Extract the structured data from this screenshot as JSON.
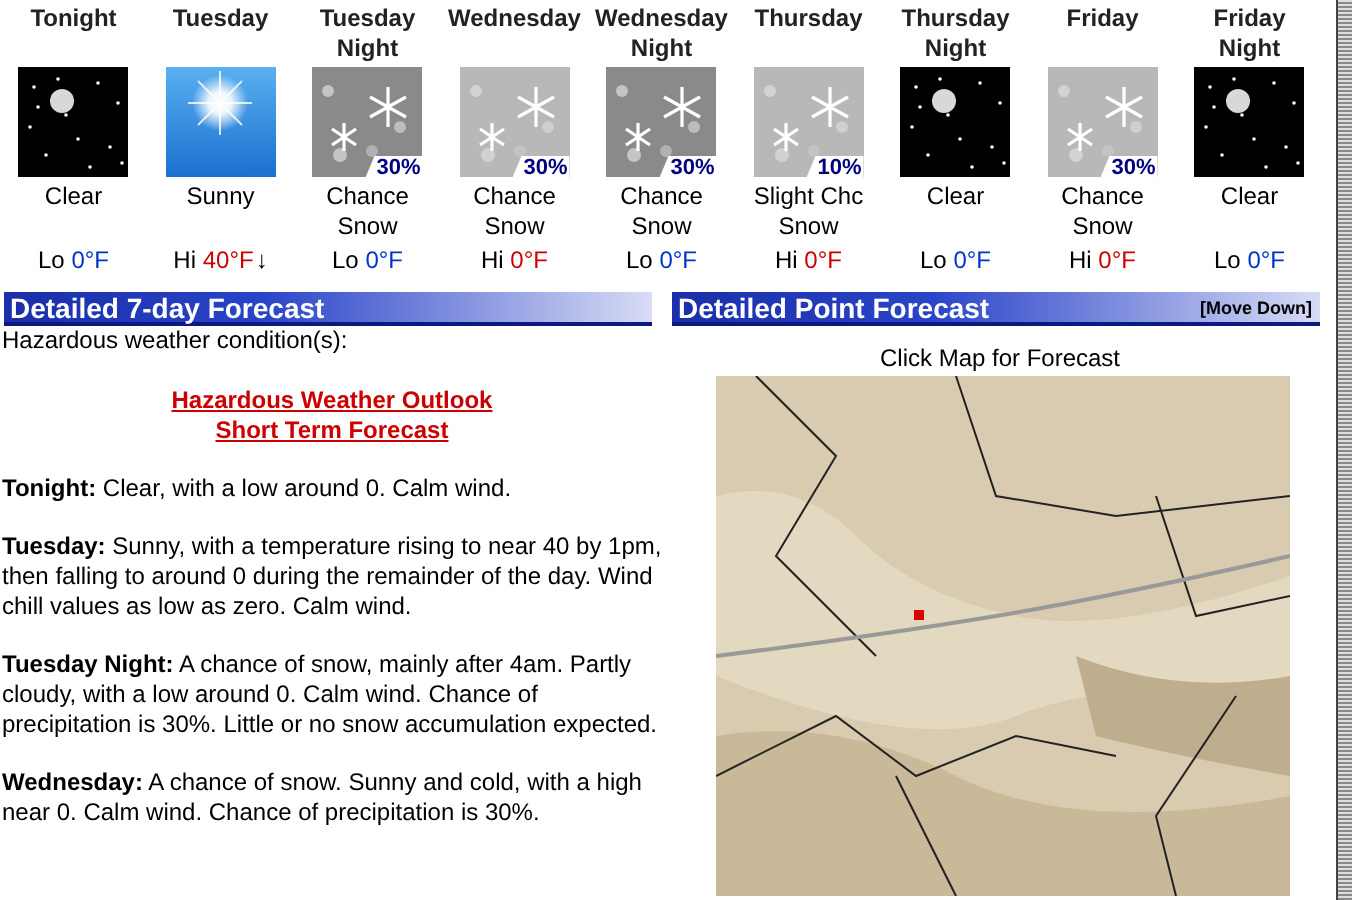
{
  "periods": [
    {
      "title": [
        "Tonight"
      ],
      "kind": "clear-night",
      "condition": "Clear",
      "temp_label": "Lo",
      "temp": "0°F",
      "color": "#0033cc"
    },
    {
      "title": [
        "Tuesday"
      ],
      "kind": "sunny",
      "condition": "Sunny",
      "temp_label": "Hi",
      "temp": "40°F",
      "color": "#cc0000",
      "trend": "↓"
    },
    {
      "title": [
        "Tuesday",
        "Night"
      ],
      "kind": "snow",
      "chance": "30%",
      "condition": "Chance Snow",
      "temp_label": "Lo",
      "temp": "0°F",
      "color": "#0033cc"
    },
    {
      "title": [
        "Wednesday"
      ],
      "kind": "snow",
      "chance": "30%",
      "condition": "Chance Snow",
      "temp_label": "Hi",
      "temp": "0°F",
      "color": "#cc0000"
    },
    {
      "title": [
        "Wednesday",
        "Night"
      ],
      "kind": "snow",
      "chance": "30%",
      "condition": "Chance Snow",
      "temp_label": "Lo",
      "temp": "0°F",
      "color": "#0033cc"
    },
    {
      "title": [
        "Thursday"
      ],
      "kind": "snow",
      "chance": "10%",
      "condition": "Slight Chc Snow",
      "temp_label": "Hi",
      "temp": "0°F",
      "color": "#cc0000"
    },
    {
      "title": [
        "Thursday",
        "Night"
      ],
      "kind": "clear-night",
      "condition": "Clear",
      "temp_label": "Lo",
      "temp": "0°F",
      "color": "#0033cc"
    },
    {
      "title": [
        "Friday"
      ],
      "kind": "snow",
      "chance": "30%",
      "condition": "Chance Snow",
      "temp_label": "Hi",
      "temp": "0°F",
      "color": "#cc0000"
    },
    {
      "title": [
        "Friday",
        "Night"
      ],
      "kind": "clear-night",
      "condition": "Clear",
      "temp_label": "Lo",
      "temp": "0°F",
      "color": "#0033cc"
    }
  ],
  "detailed": {
    "title": "Detailed 7-day Forecast",
    "hazard_label": "Hazardous weather condition(s):",
    "hazard_links": [
      "Hazardous Weather Outlook",
      "Short Term Forecast"
    ],
    "paragraphs": [
      "**Tonight:** Clear, with a low around 0. Calm wind.",
      "**Tuesday:** Sunny, with a temperature rising to near 40 by 1pm, then falling to around 0 during the remainder of the day. Wind chill values as low as zero. Calm wind.",
      "**Tuesday Night:** A chance of snow, mainly after 4am. Partly cloudy, with a low around 0. Calm wind. Chance of precipitation is 30%. Little or no snow accumulation expected.",
      "**Wednesday:** A chance of snow. Sunny and cold, with a high near 0. Calm wind. Chance of precipitation is 30%."
    ]
  },
  "point": {
    "title": "Detailed Point Forecast",
    "move_link": "[Move Down]",
    "map_caption": "Click Map for Forecast"
  }
}
